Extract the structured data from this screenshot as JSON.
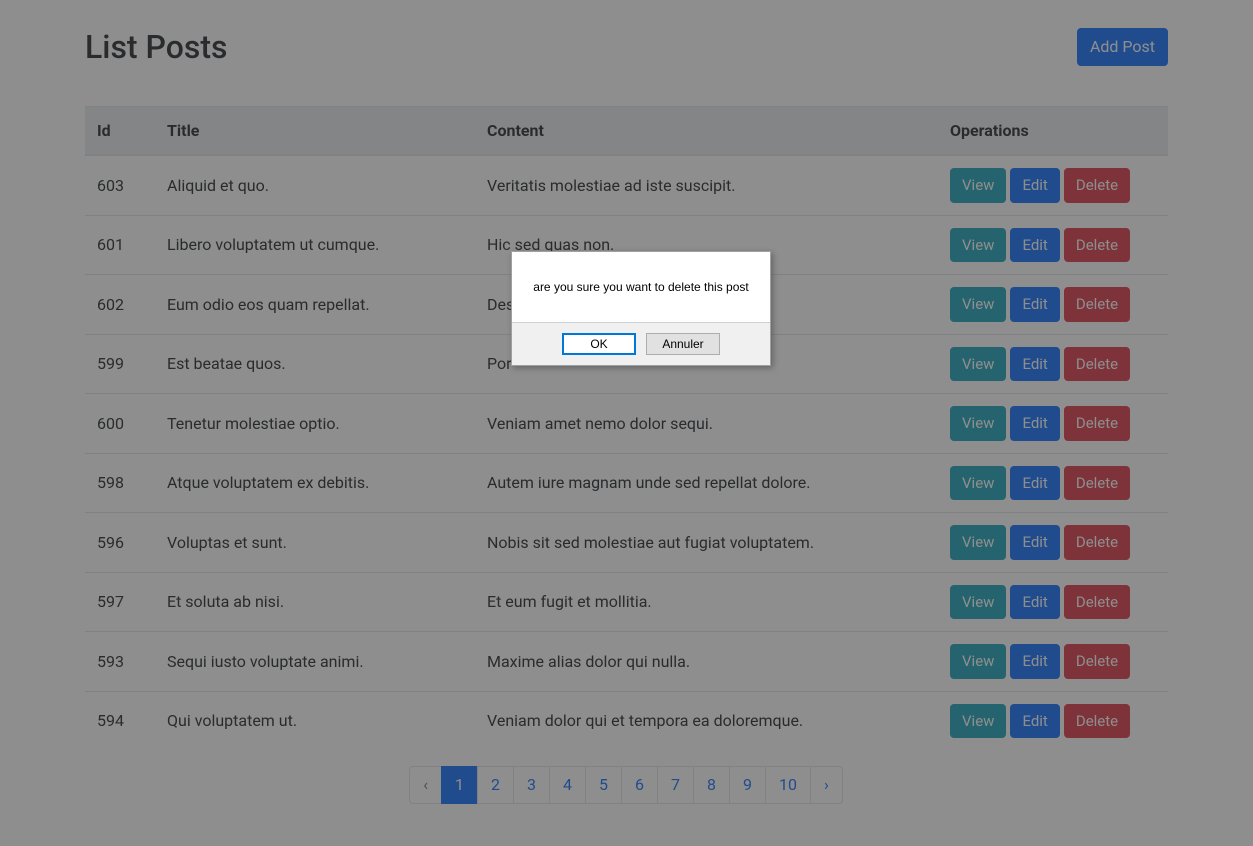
{
  "header": {
    "title": "List Posts",
    "add_post_label": "Add Post"
  },
  "table": {
    "columns": {
      "id": "Id",
      "title": "Title",
      "content": "Content",
      "operations": "Operations"
    },
    "ops": {
      "view": "View",
      "edit": "Edit",
      "delete": "Delete"
    },
    "rows": [
      {
        "id": "603",
        "title": "Aliquid et quo.",
        "content": "Veritatis molestiae ad iste suscipit."
      },
      {
        "id": "601",
        "title": "Libero voluptatem ut cumque.",
        "content": "Hic sed quas non."
      },
      {
        "id": "602",
        "title": "Eum odio eos quam repellat.",
        "content": "Des"
      },
      {
        "id": "599",
        "title": "Est beatae quos.",
        "content": "Por"
      },
      {
        "id": "600",
        "title": "Tenetur molestiae optio.",
        "content": "Veniam amet nemo dolor sequi."
      },
      {
        "id": "598",
        "title": "Atque voluptatem ex debitis.",
        "content": "Autem iure magnam unde sed repellat dolore."
      },
      {
        "id": "596",
        "title": "Voluptas et sunt.",
        "content": "Nobis sit sed molestiae aut fugiat voluptatem."
      },
      {
        "id": "597",
        "title": "Et soluta ab nisi.",
        "content": "Et eum fugit et mollitia."
      },
      {
        "id": "593",
        "title": "Sequi iusto voluptate animi.",
        "content": "Maxime alias dolor qui nulla."
      },
      {
        "id": "594",
        "title": "Qui voluptatem ut.",
        "content": "Veniam dolor qui et tempora ea doloremque."
      }
    ]
  },
  "pagination": {
    "prev": "‹",
    "next": "›",
    "pages": [
      "1",
      "2",
      "3",
      "4",
      "5",
      "6",
      "7",
      "8",
      "9",
      "10"
    ],
    "active": "1"
  },
  "dialog": {
    "message": "are you sure you want to delete this post",
    "ok": "OK",
    "cancel": "Annuler"
  }
}
